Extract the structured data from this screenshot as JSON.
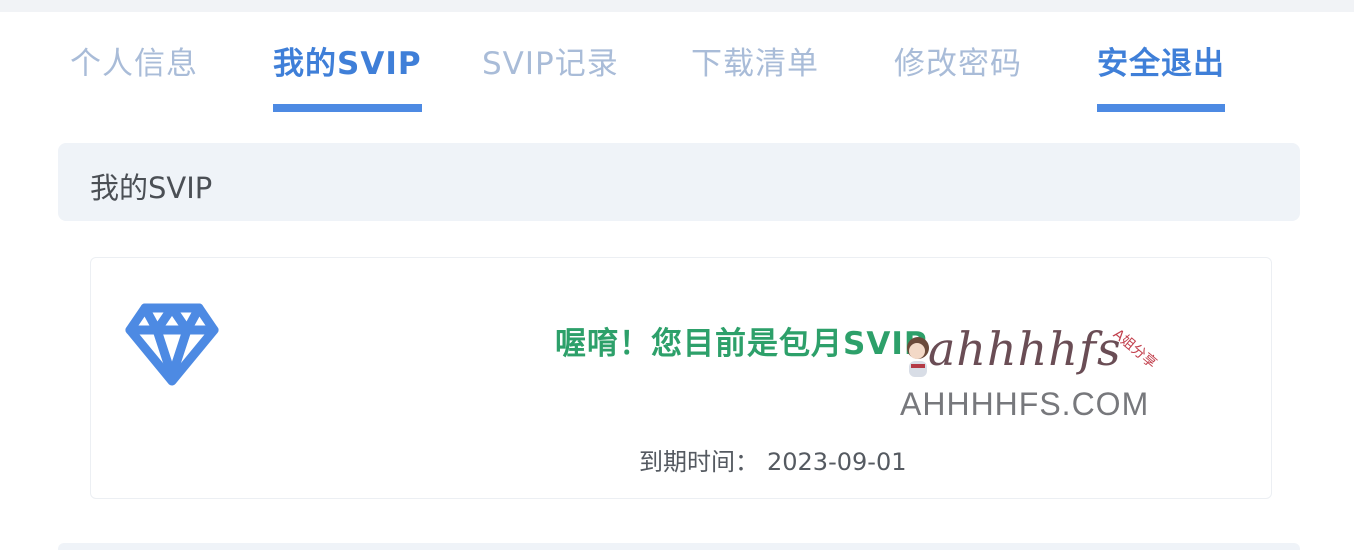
{
  "tabs": [
    {
      "label": "个人信息",
      "state": "inactive"
    },
    {
      "label": "我的SVIP",
      "state": "active"
    },
    {
      "label": "SVIP记录",
      "state": "inactive"
    },
    {
      "label": "下载清单",
      "state": "inactive"
    },
    {
      "label": "修改密码",
      "state": "inactive"
    },
    {
      "label": "安全退出",
      "state": "highlighted"
    }
  ],
  "section": {
    "title": "我的SVIP"
  },
  "card": {
    "icon": "diamond-icon",
    "status_message": "喔唷！您目前是包月SVIP",
    "expiry_label": "到期时间：",
    "expiry_value": "2023-09-01"
  },
  "watermark": {
    "script_text": "ahhhhfs",
    "tag_text": "A姐分享",
    "domain_text": "AHHHHFS.COM"
  },
  "colors": {
    "accent": "#4d8ae3",
    "tab_inactive": "#a9bcd8",
    "success": "#2da06a",
    "panel_bg": "#eff3f8"
  }
}
